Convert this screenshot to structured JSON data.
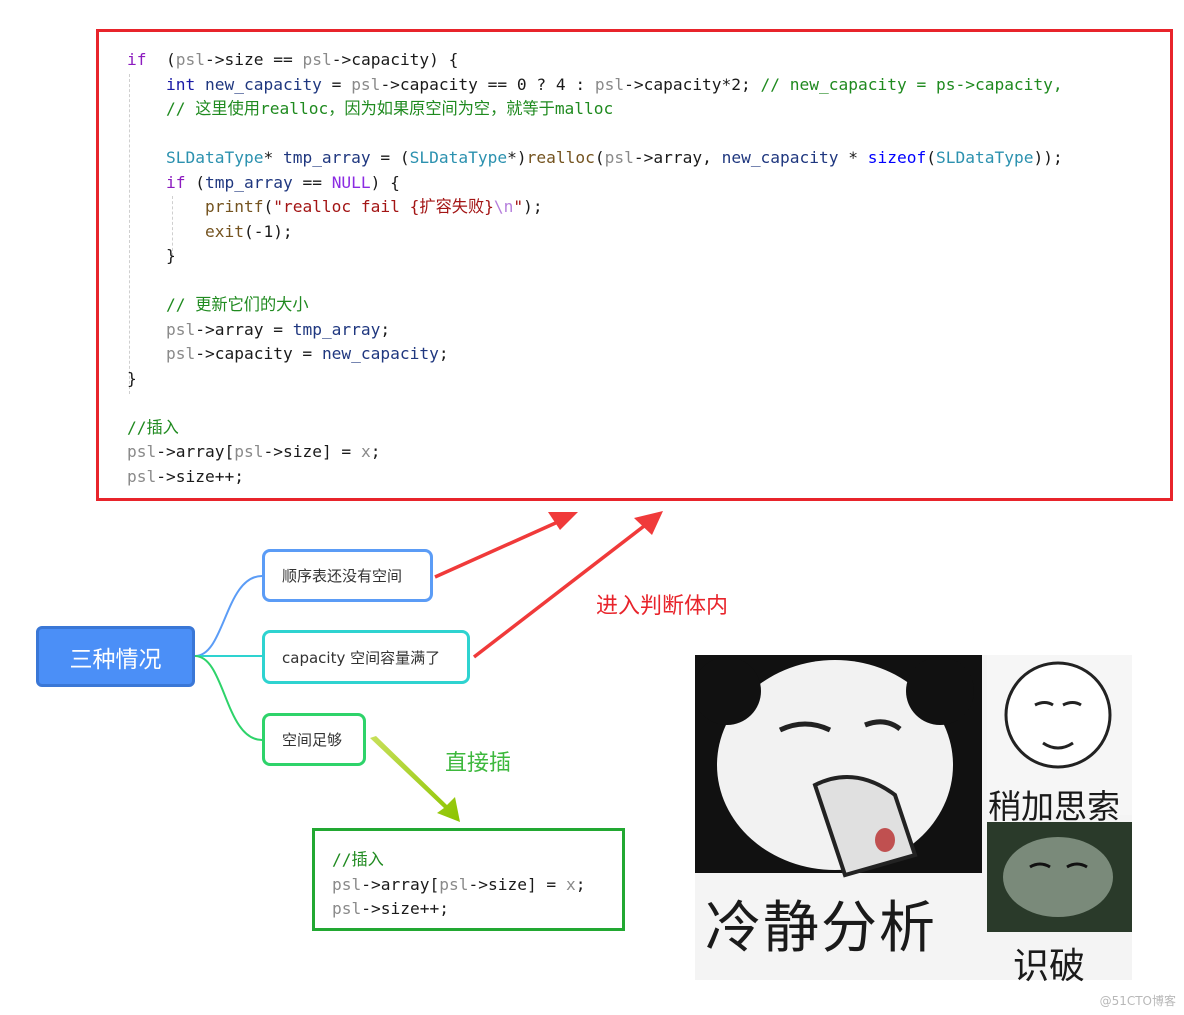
{
  "code_box": {
    "border_color": "#e8242b",
    "lines": [
      [
        [
          "kw",
          "if"
        ],
        [
          "",
          "  ("
        ],
        [
          "mu",
          "psl"
        ],
        [
          "",
          "->size == "
        ],
        [
          "mu",
          "psl"
        ],
        [
          "",
          "->capacity) {"
        ]
      ],
      [
        [
          "",
          "    "
        ],
        [
          "ty",
          "int"
        ],
        [
          "",
          " "
        ],
        [
          "var",
          "new_capacity"
        ],
        [
          "",
          " = "
        ],
        [
          "mu",
          "psl"
        ],
        [
          "",
          "->capacity == 0 ? 4 : "
        ],
        [
          "mu",
          "psl"
        ],
        [
          "",
          "->capacity*2; "
        ],
        [
          "cm",
          "// new_capacity = ps->capacity,"
        ]
      ],
      [
        [
          "",
          "    "
        ],
        [
          "cm",
          "// 这里使用realloc，因为如果原空间为空，就等于malloc"
        ]
      ],
      [
        [
          "",
          ""
        ]
      ],
      [
        [
          "",
          "    "
        ],
        [
          "ty2",
          "SLDataType"
        ],
        [
          "",
          "* "
        ],
        [
          "var",
          "tmp_array"
        ],
        [
          "",
          " = ("
        ],
        [
          "ty2",
          "SLDataType"
        ],
        [
          "",
          "*)"
        ],
        [
          "fn",
          "realloc"
        ],
        [
          "",
          "("
        ],
        [
          "mu",
          "psl"
        ],
        [
          "",
          "->array, "
        ],
        [
          "var",
          "new_capacity"
        ],
        [
          "",
          " * "
        ],
        [
          "sz",
          "sizeof"
        ],
        [
          "",
          "("
        ],
        [
          "ty2",
          "SLDataType"
        ],
        [
          "",
          "));"
        ]
      ],
      [
        [
          "",
          "    "
        ],
        [
          "kw",
          "if"
        ],
        [
          "",
          " ("
        ],
        [
          "var",
          "tmp_array"
        ],
        [
          "",
          " == "
        ],
        [
          "macro",
          "NULL"
        ],
        [
          "",
          ") {"
        ]
      ],
      [
        [
          "",
          "        "
        ],
        [
          "fn",
          "printf"
        ],
        [
          "",
          "("
        ],
        [
          "str",
          "\"realloc fail {扩容失败}"
        ],
        [
          "esc",
          "\\n"
        ],
        [
          "str",
          "\""
        ],
        [
          "",
          ");"
        ]
      ],
      [
        [
          "",
          "        "
        ],
        [
          "fn",
          "exit"
        ],
        [
          "",
          "(-1);"
        ]
      ],
      [
        [
          "",
          "    }"
        ]
      ],
      [
        [
          "",
          ""
        ]
      ],
      [
        [
          "",
          "    "
        ],
        [
          "cm",
          "// 更新它们的大小"
        ]
      ],
      [
        [
          "",
          "    "
        ],
        [
          "mu",
          "psl"
        ],
        [
          "",
          "->array = "
        ],
        [
          "var",
          "tmp_array"
        ],
        [
          "",
          ";"
        ]
      ],
      [
        [
          "",
          "    "
        ],
        [
          "mu",
          "psl"
        ],
        [
          "",
          "->capacity = "
        ],
        [
          "var",
          "new_capacity"
        ],
        [
          "",
          ";"
        ]
      ],
      [
        [
          "",
          "}"
        ]
      ],
      [
        [
          "",
          ""
        ]
      ],
      [
        [
          "cm",
          "//插入"
        ]
      ],
      [
        [
          "mu",
          "psl"
        ],
        [
          "",
          "->array["
        ],
        [
          "mu",
          "psl"
        ],
        [
          "",
          "->size] = "
        ],
        [
          "mu",
          "x"
        ],
        [
          "",
          ";"
        ]
      ],
      [
        [
          "mu",
          "psl"
        ],
        [
          "",
          "->size++;"
        ]
      ]
    ]
  },
  "mindmap": {
    "root": "三种情况",
    "branches": [
      {
        "label": "顺序表还没有空间",
        "color": "#5b9cf6"
      },
      {
        "label": "capacity 空间容量满了",
        "color": "#2ed3d0"
      },
      {
        "label": "空间足够",
        "color": "#2ed36a"
      }
    ]
  },
  "annotations": {
    "enter_branch": "进入判断体内",
    "direct_insert": "直接插"
  },
  "green_box": {
    "lines": [
      [
        [
          "cm",
          "//插入"
        ]
      ],
      [
        [
          "mu",
          "psl"
        ],
        [
          "",
          "->array["
        ],
        [
          "mu",
          "psl"
        ],
        [
          "",
          "->size] = "
        ],
        [
          "mu",
          "x"
        ],
        [
          "",
          ";"
        ]
      ],
      [
        [
          "mu",
          "psl"
        ],
        [
          "",
          "->size++;"
        ]
      ]
    ]
  },
  "meme": {
    "main_caption": "冷静分析",
    "top_right_caption": "稍加思索",
    "bottom_right_caption": "识破"
  },
  "watermark": "@51CTO博客"
}
